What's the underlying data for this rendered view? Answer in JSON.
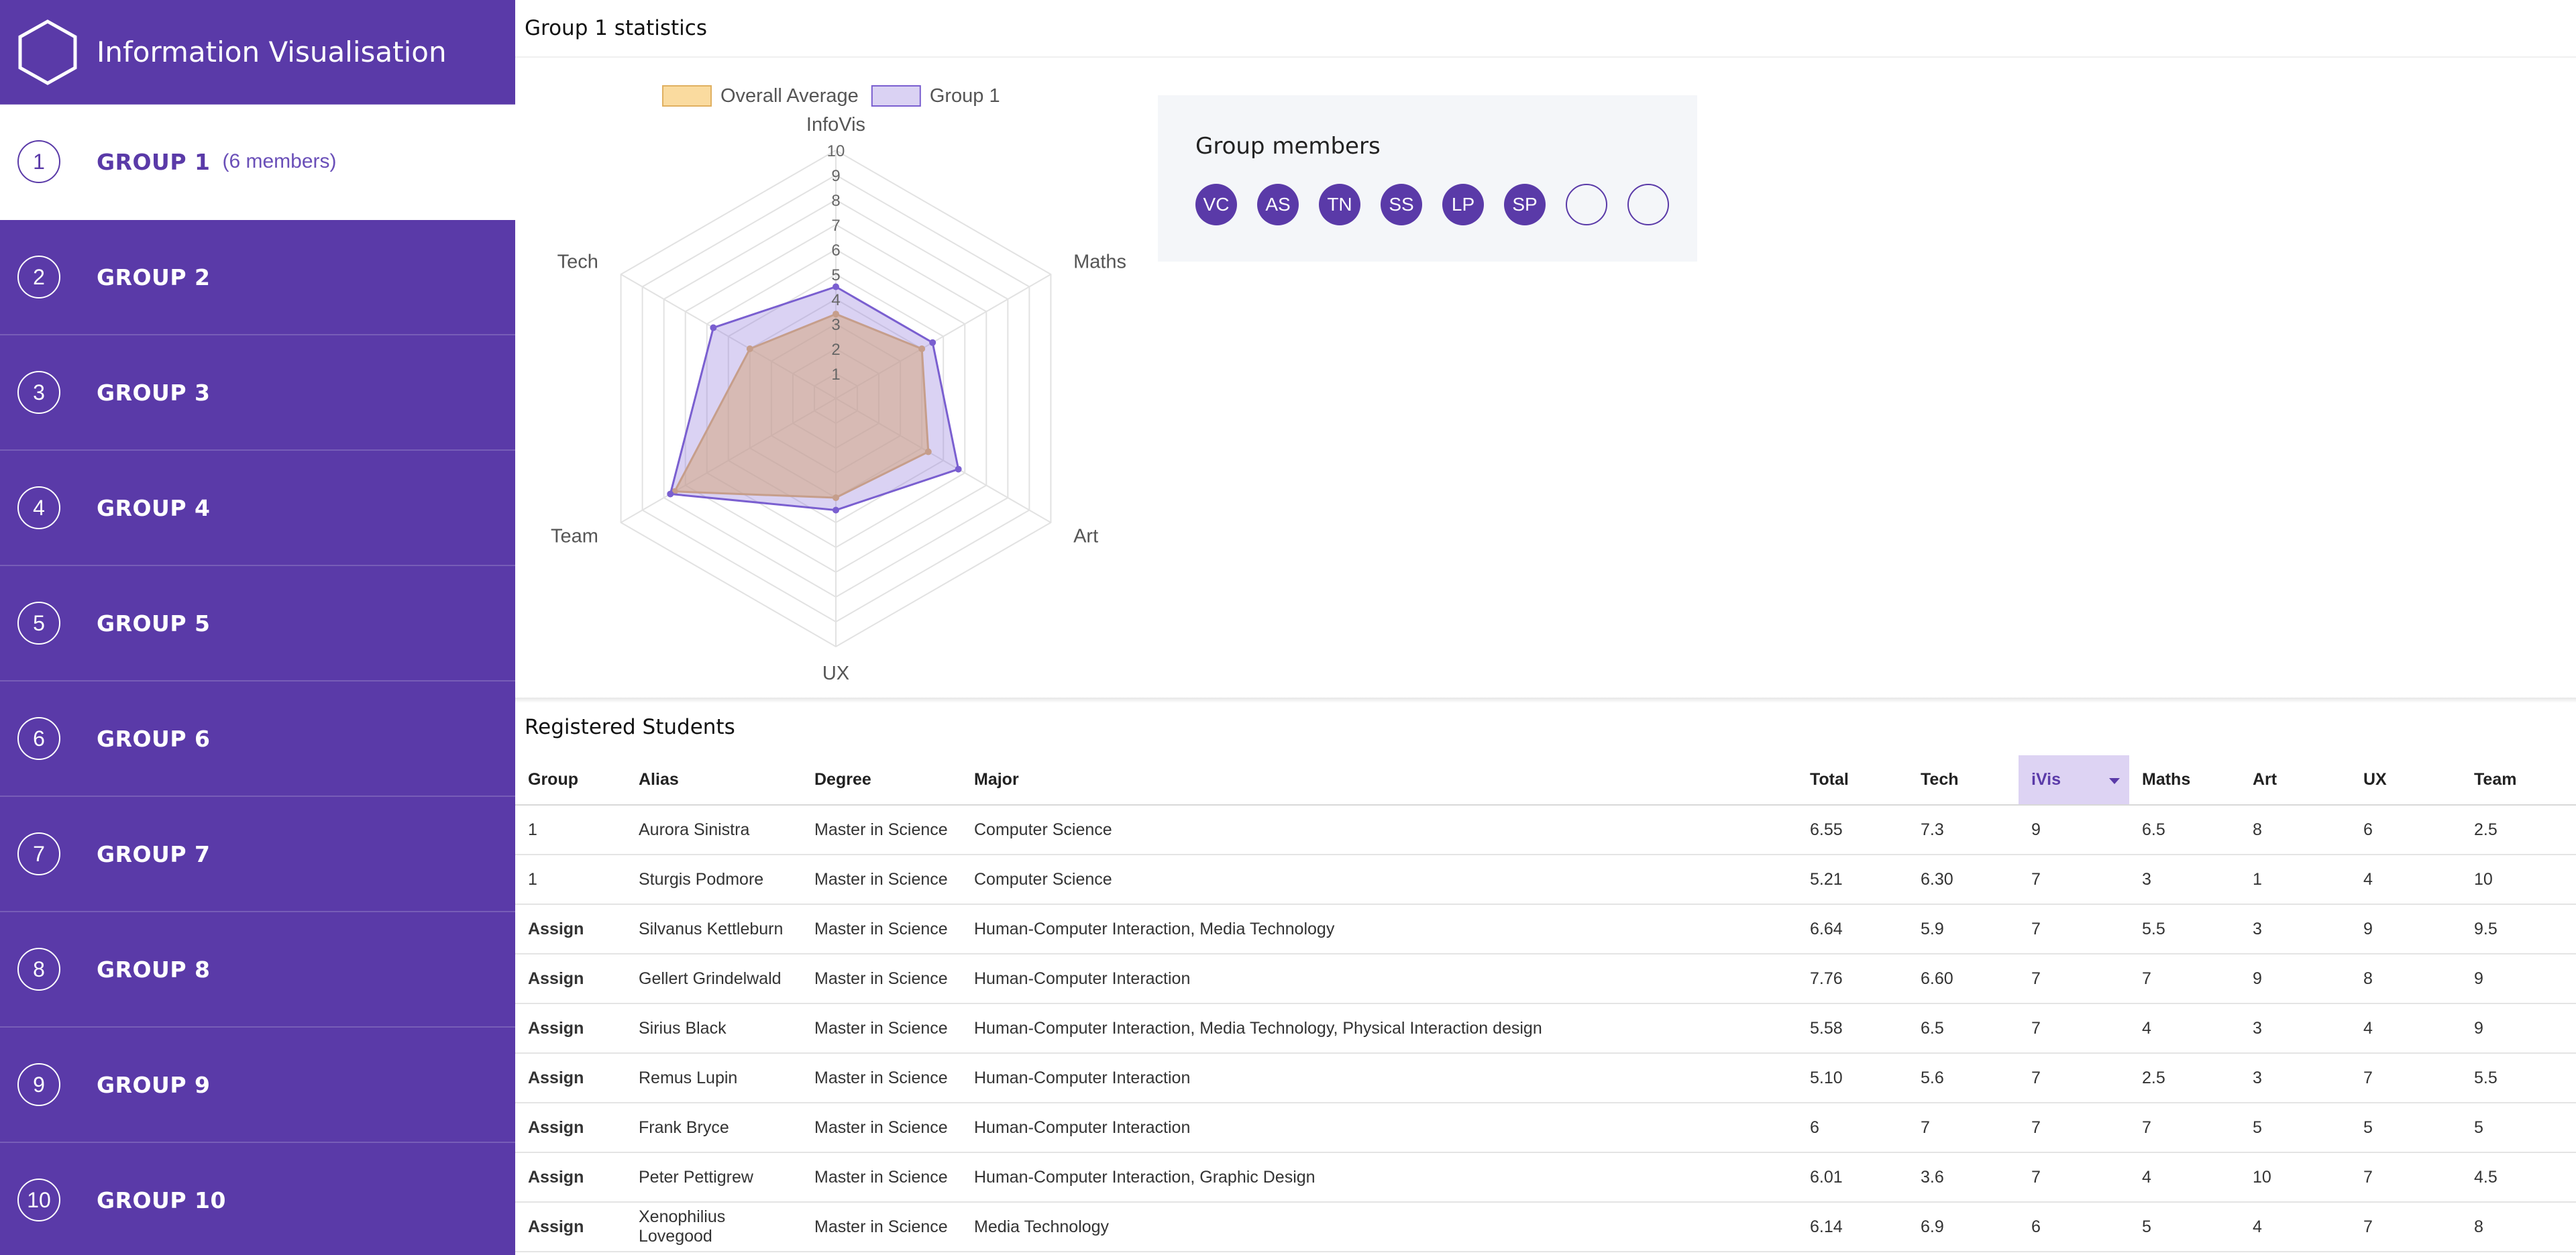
{
  "app": {
    "title": "Information Visualisation"
  },
  "sidebar": {
    "groups": [
      {
        "number": "1",
        "label": "GROUP 1",
        "members": "(6 members)"
      },
      {
        "number": "2",
        "label": "GROUP 2"
      },
      {
        "number": "3",
        "label": "GROUP 3"
      },
      {
        "number": "4",
        "label": "GROUP 4"
      },
      {
        "number": "5",
        "label": "GROUP 5"
      },
      {
        "number": "6",
        "label": "GROUP 6"
      },
      {
        "number": "7",
        "label": "GROUP 7"
      },
      {
        "number": "8",
        "label": "GROUP 8"
      },
      {
        "number": "9",
        "label": "GROUP 9"
      },
      {
        "number": "10",
        "label": "GROUP 10"
      }
    ]
  },
  "stats": {
    "title": "Group 1 statistics",
    "members_title": "Group members",
    "members": [
      "VC",
      "AS",
      "TN",
      "SS",
      "LP",
      "SP",
      "",
      ""
    ]
  },
  "chart_data": {
    "type": "radar",
    "axes": [
      "InfoVis",
      "Maths",
      "Art",
      "UX",
      "Team",
      "Tech"
    ],
    "ticks": [
      "1",
      "2",
      "3",
      "4",
      "5",
      "6",
      "7",
      "8",
      "9",
      "10"
    ],
    "range": [
      0,
      10
    ],
    "legend_position": "top",
    "series": [
      {
        "name": "Overall Average",
        "values": [
          3.4,
          4.0,
          4.3,
          4.0,
          7.5,
          4.0
        ],
        "color": "#f5c86e"
      },
      {
        "name": "Group 1",
        "values": [
          4.5,
          4.5,
          5.7,
          4.5,
          7.7,
          5.7
        ],
        "color": "#a99be0"
      }
    ]
  },
  "students": {
    "title": "Registered Students",
    "columns": [
      "Group",
      "Alias",
      "Degree",
      "Major",
      "Total",
      "Tech",
      "iVis",
      "Maths",
      "Art",
      "UX",
      "Team"
    ],
    "sorted_column": "iVis",
    "rows": [
      {
        "group": "1",
        "alias": "Aurora Sinistra",
        "degree": "Master in Science",
        "major": "Computer Science",
        "total": "6.55",
        "tech": "7.3",
        "ivis": "9",
        "maths": "6.5",
        "art": "8",
        "ux": "6",
        "team": "2.5"
      },
      {
        "group": "1",
        "alias": "Sturgis Podmore",
        "degree": "Master in Science",
        "major": "Computer Science",
        "total": "5.21",
        "tech": "6.30",
        "ivis": "7",
        "maths": "3",
        "art": "1",
        "ux": "4",
        "team": "10"
      },
      {
        "group": "Assign",
        "alias": "Silvanus Kettleburn",
        "degree": "Master in Science",
        "major": "Human-Computer Interaction, Media Technology",
        "total": "6.64",
        "tech": "5.9",
        "ivis": "7",
        "maths": "5.5",
        "art": "3",
        "ux": "9",
        "team": "9.5"
      },
      {
        "group": "Assign",
        "alias": "Gellert Grindelwald",
        "degree": "Master in Science",
        "major": "Human-Computer Interaction",
        "total": "7.76",
        "tech": "6.60",
        "ivis": "7",
        "maths": "7",
        "art": "9",
        "ux": "8",
        "team": "9"
      },
      {
        "group": "Assign",
        "alias": "Sirius Black",
        "degree": "Master in Science",
        "major": "Human-Computer Interaction, Media Technology, Physical Interaction design",
        "total": "5.58",
        "tech": "6.5",
        "ivis": "7",
        "maths": "4",
        "art": "3",
        "ux": "4",
        "team": "9"
      },
      {
        "group": "Assign",
        "alias": "Remus Lupin",
        "degree": "Master in Science",
        "major": "Human-Computer Interaction",
        "total": "5.10",
        "tech": "5.6",
        "ivis": "7",
        "maths": "2.5",
        "art": "3",
        "ux": "7",
        "team": "5.5"
      },
      {
        "group": "Assign",
        "alias": "Frank Bryce",
        "degree": "Master in Science",
        "major": "Human-Computer Interaction",
        "total": "6",
        "tech": "7",
        "ivis": "7",
        "maths": "7",
        "art": "5",
        "ux": "5",
        "team": "5"
      },
      {
        "group": "Assign",
        "alias": "Peter Pettigrew",
        "degree": "Master in Science",
        "major": "Human-Computer Interaction, Graphic Design",
        "total": "6.01",
        "tech": "3.6",
        "ivis": "7",
        "maths": "4",
        "art": "10",
        "ux": "7",
        "team": "4.5"
      },
      {
        "group": "Assign",
        "alias": "Xenophilius Lovegood",
        "degree": "Master in Science",
        "major": "Media Technology",
        "total": "6.14",
        "tech": "6.9",
        "ivis": "6",
        "maths": "5",
        "art": "4",
        "ux": "7",
        "team": "8"
      }
    ]
  }
}
